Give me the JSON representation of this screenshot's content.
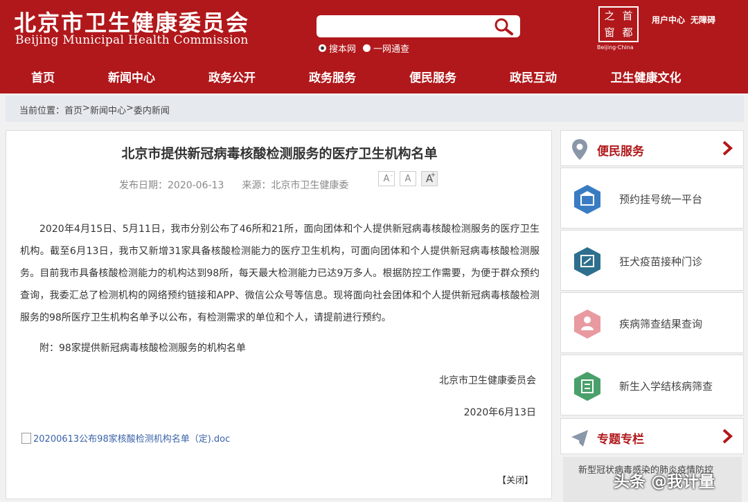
{
  "header": {
    "logo_cn": "北京市卫生健康委员会",
    "logo_en": "Beijing Municipal Health Commission",
    "search_placeholder": "",
    "radio_site": "搜本网",
    "radio_all": "一网通查",
    "capital_chars": [
      "之",
      "首",
      "窗",
      "都"
    ],
    "capital_sub": "Beijing·China",
    "user_center": "用户中心",
    "accessibility": "无障碍"
  },
  "nav": [
    "首页",
    "新闻中心",
    "政务公开",
    "政务服务",
    "便民服务",
    "政民互动",
    "卫生健康文化"
  ],
  "breadcrumb": {
    "prefix": "当前位置：",
    "items": [
      "首页",
      ">",
      "新闻中心",
      ">",
      "委内新闻"
    ]
  },
  "article": {
    "title": "北京市提供新冠病毒核酸检测服务的医疗卫生机构名单",
    "publish_date": "发布日期：2020-06-13",
    "source": "来源：北京市卫生健康委",
    "font_small": "A",
    "font_mid": "A",
    "font_big": "A",
    "body": "2020年4月15日、5月11日，我市分别公布了46所和21所，面向团体和个人提供新冠病毒核酸检测服务的医疗卫生机构。截至6月13日，我市又新增31家具备核酸检测能力的医疗卫生机构，可面向团体和个人提供新冠病毒核酸检测服务。目前我市具备核酸检测能力的机构达到98所，每天最大检测能力已达9万多人。根据防控工作需要，为便于群众预约查询，我委汇总了检测机构的网络预约链接和APP、微信公众号等信息。现将面向社会团体和个人提供新冠病毒核酸检测服务的98所医疗卫生机构名单予以公布，有检测需求的单位和个人，请提前进行预约。",
    "attachment": "附：98家提供新冠病毒核酸检测服务的机构名单",
    "signature": "北京市卫生健康委员会",
    "date": "2020年6月13日",
    "doc_link": "20200613公布98家核酸检测机构名单（定).doc",
    "close": "【关闭】"
  },
  "sidebar": {
    "convenience_title": "便民服务",
    "services": [
      {
        "label": "预约挂号统一平台",
        "color": "#3a7cc2"
      },
      {
        "label": "狂犬疫苗接种门诊",
        "color": "#2e6f8e"
      },
      {
        "label": "疾病筛查结果查询",
        "color": "#e89aa0"
      },
      {
        "label": "新生入学结核病筛查",
        "color": "#4aa06a"
      }
    ],
    "special_title": "专题专栏",
    "special_item": "新型冠状病毒感染的肺炎疫情防控"
  },
  "watermark": "头条 @我计量",
  "colors": {
    "brand": "#b1181b",
    "link": "#3a62a8"
  }
}
